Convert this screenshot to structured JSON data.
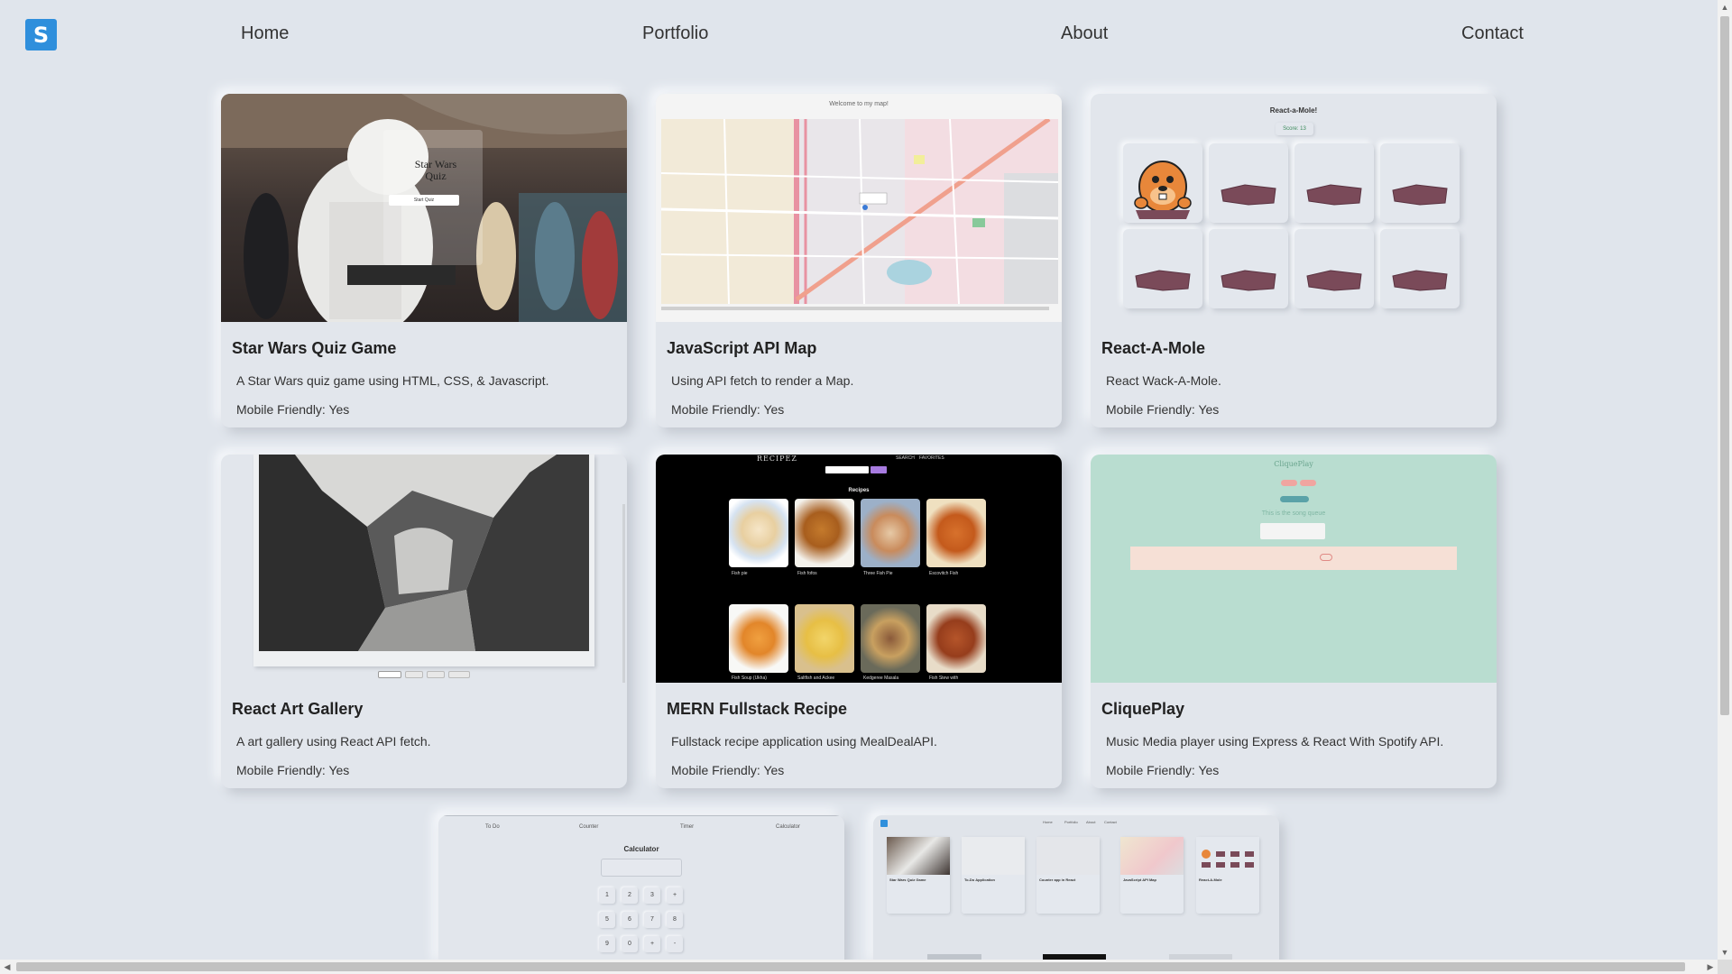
{
  "logo": {
    "letter": "S"
  },
  "nav": {
    "home": "Home",
    "portfolio": "Portfolio",
    "about": "About",
    "contact": "Contact"
  },
  "cards": [
    {
      "title": "Star Wars Quiz Game",
      "desc": "A Star Wars quiz game using HTML, CSS, & Javascript.",
      "mobile": "Mobile Friendly: Yes",
      "thumb": {
        "quiz_title_line1": "Star Wars",
        "quiz_title_line2": "Quiz",
        "start_button": "Start Quiz"
      }
    },
    {
      "title": "JavaScript API Map",
      "desc": "Using API fetch to render a Map.",
      "mobile": "Mobile Friendly: Yes",
      "thumb": {
        "header": "Welcome to my map!"
      }
    },
    {
      "title": "React-A-Mole",
      "desc": "React Wack-A-Mole.",
      "mobile": "Mobile Friendly: Yes",
      "thumb": {
        "header": "React-a-Mole!",
        "score": "Score: 13"
      }
    },
    {
      "title": "React Art Gallery",
      "desc": "A art gallery using React API fetch.",
      "mobile": "Mobile Friendly: Yes"
    },
    {
      "title": "MERN Fullstack Recipe",
      "desc": "Fullstack recipe application using MealDealAPI.",
      "mobile": "Mobile Friendly: Yes",
      "thumb": {
        "brand": "RECIPEZ",
        "nav_search": "SEARCH",
        "nav_favorites": "FAVORITES",
        "section": "Recipes",
        "items": [
          "Fish pie",
          "Fish fofos",
          "Three Fish Pie",
          "Escovitch Fish",
          "Fish Soup (Ukha)",
          "Saltfish and Ackee",
          "Kedgeree Masala",
          "Fish Stew with"
        ]
      }
    },
    {
      "title": "CliquePlay",
      "desc": "Music Media player using Express & React With Spotify API.",
      "mobile": "Mobile Friendly: Yes",
      "thumb": {
        "brand": "CliquePlay",
        "queue_heading": "This is the song queue"
      }
    }
  ],
  "partial_cards": [
    {
      "thumb": {
        "tabs": [
          "To Do",
          "Counter",
          "Timer",
          "Calculator"
        ],
        "heading": "Calculator",
        "keys": [
          "1",
          "2",
          "3",
          "+",
          "5",
          "6",
          "7",
          "8",
          "9",
          "0",
          "+",
          "-"
        ]
      }
    },
    {
      "thumb": {
        "nav": [
          "Home",
          "Portfolio",
          "About",
          "Contact"
        ],
        "mini_titles": [
          "Star Wars Quiz Game",
          "To-Do Application",
          "Counter app in React",
          "JavaScript API Map",
          "React-A-Mole"
        ]
      }
    }
  ],
  "colors": {
    "background": "#e0e5ec",
    "logo": "#2f8fdc",
    "mole_rock": "#7a4a59",
    "clique_bg": "#b9ddd0"
  }
}
